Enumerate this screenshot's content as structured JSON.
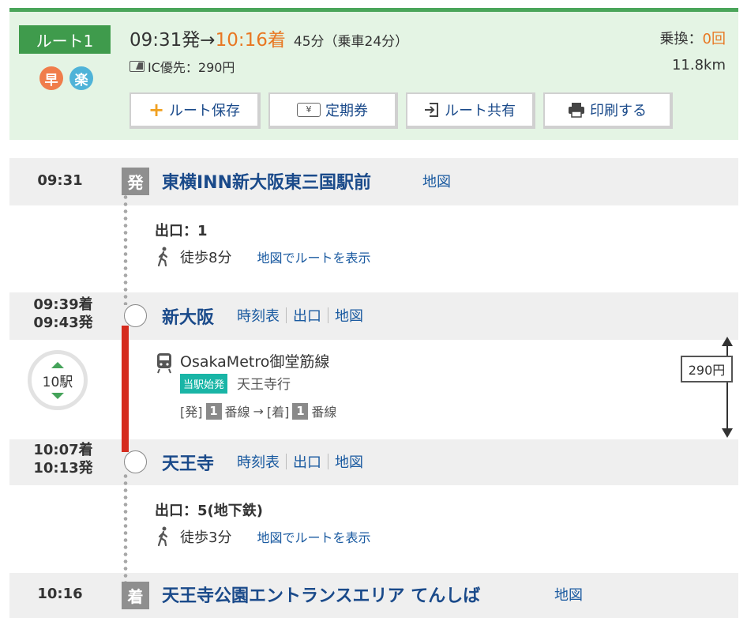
{
  "route": {
    "label": "ルート1",
    "badge_fast": "早",
    "badge_easy": "楽",
    "depart": "09:31発",
    "arrow": "→",
    "arrive": "10:16着",
    "duration": "45分（乗車24分）",
    "transfer_label": "乗換：",
    "transfer_count": "0回",
    "fare": "IC優先：290円",
    "distance": "11.8km",
    "colors": {
      "accent_green": "#3f9b4c",
      "time_orange": "#e87722",
      "link_blue": "#1a5aa0",
      "rail_red": "#d52b1e"
    }
  },
  "actions": {
    "save": "ルート保存",
    "pass": "定期券",
    "pass_icon_text": "¥",
    "share": "ルート共有",
    "print": "印刷する"
  },
  "stations": [
    {
      "time": "09:31",
      "mark": "発",
      "name": "東横INN新大阪東三国駅前",
      "links": [
        "地図"
      ]
    },
    {
      "time_arr": "09:39着",
      "time_dep": "09:43発",
      "name": "新大阪",
      "links": [
        "時刻表",
        "出口",
        "地図"
      ]
    },
    {
      "time_arr": "10:07着",
      "time_dep": "10:13発",
      "name": "天王寺",
      "links": [
        "時刻表",
        "出口",
        "地図"
      ]
    },
    {
      "time": "10:16",
      "mark": "着",
      "name": "天王寺公園エントランスエリア てんしば",
      "links": [
        "地図"
      ]
    }
  ],
  "walks": [
    {
      "exit": "出口：1",
      "walk": "徒歩8分",
      "map_link": "地図でルートを表示"
    },
    {
      "exit": "出口：5(地下鉄)",
      "walk": "徒歩3分",
      "map_link": "地図でルートを表示"
    }
  ],
  "train": {
    "stops": "10駅",
    "line": "OsakaMetro御堂筋線",
    "origin_tag": "当駅始発",
    "destination": "天王寺行",
    "dep_prefix": "[発]",
    "dep_platform": "1",
    "platform_suffix": "番線",
    "arrow": "→",
    "arr_prefix": "[着]",
    "arr_platform": "1",
    "fare": "290円"
  }
}
